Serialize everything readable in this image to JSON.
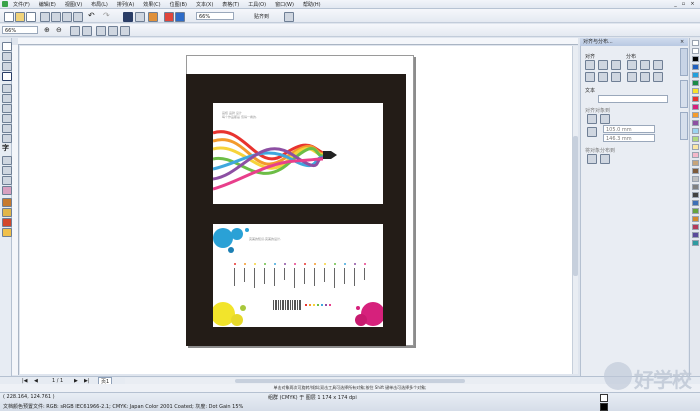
{
  "menubar": {
    "items": [
      "文件(F)",
      "编辑(E)",
      "视图(V)",
      "布局(L)",
      "排列(A)",
      "效果(C)",
      "位图(B)",
      "文本(X)",
      "表格(T)",
      "工具(O)",
      "窗口(W)",
      "帮助(H)"
    ]
  },
  "toolbar": {
    "zoom_value": "66%",
    "snap_label": "贴齐到",
    "zoom2_value": "66%"
  },
  "docker": {
    "title": "对齐与分布...",
    "align_label": "对齐",
    "distribute_label": "分布",
    "text_label": "文本",
    "to_label": "对齐对象到",
    "val1": "105.0 mm",
    "val2": "146.3 mm",
    "dist_label": "将对象分布到"
  },
  "artwork": {
    "card1_text": "画框 品牌 设计\n每个作品都是 值得一看的,",
    "card2_text": "完美的知识,完美的设计,"
  },
  "pager": {
    "page_count": "1 / 1",
    "page_tab": "页1"
  },
  "hint_text": "单击对象两次可旋转/倾斜;双击工具可选择所有对象;按住 Shift 键单击可选择多个对象;",
  "status": {
    "coords": "( 228.164, 124.761 )",
    "profile": "文档颜色预置文件: RGB: sRGB IEC61966-2.1; CMYK: Japan Color 2001 Coated; 灰度: Dot Gain 15%",
    "object": "组群 (CMYK) 于 图层 1 174 x 174 dpi"
  },
  "watermark": "好学校",
  "colors": {
    "canvas_bg": "#ffffff",
    "page_bg": "#231c17",
    "accent_blue": "#2a3d66"
  }
}
